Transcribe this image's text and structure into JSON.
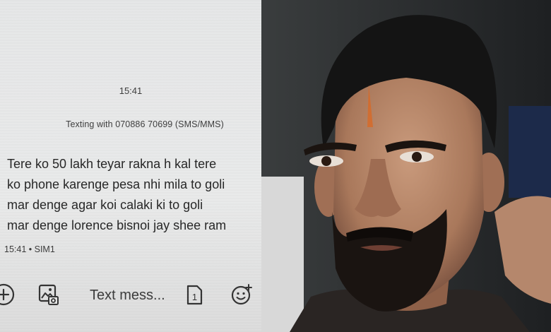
{
  "sms": {
    "time_header": "15:41",
    "texting_with": "Texting with 070886 70699 (SMS/MMS)",
    "message_lines": [
      "Tere ko 50 lakh teyar rakna h kal tere",
      "ko phone karenge pesa nhi mila to goli",
      "mar denge agar koi calaki ki to goli",
      "mar denge lorence bisnoi jay shee ram"
    ],
    "message_time": "15:41",
    "sim_label": "SIM1",
    "compose_placeholder": "Text mess...",
    "sim_button_number": "1",
    "icons": [
      "add-icon",
      "gallery-icon",
      "sim-icon",
      "emoji-icon"
    ]
  },
  "colors": {
    "paper": "#e7e8e9",
    "text": "#262626",
    "photo_background": "#25282a"
  }
}
